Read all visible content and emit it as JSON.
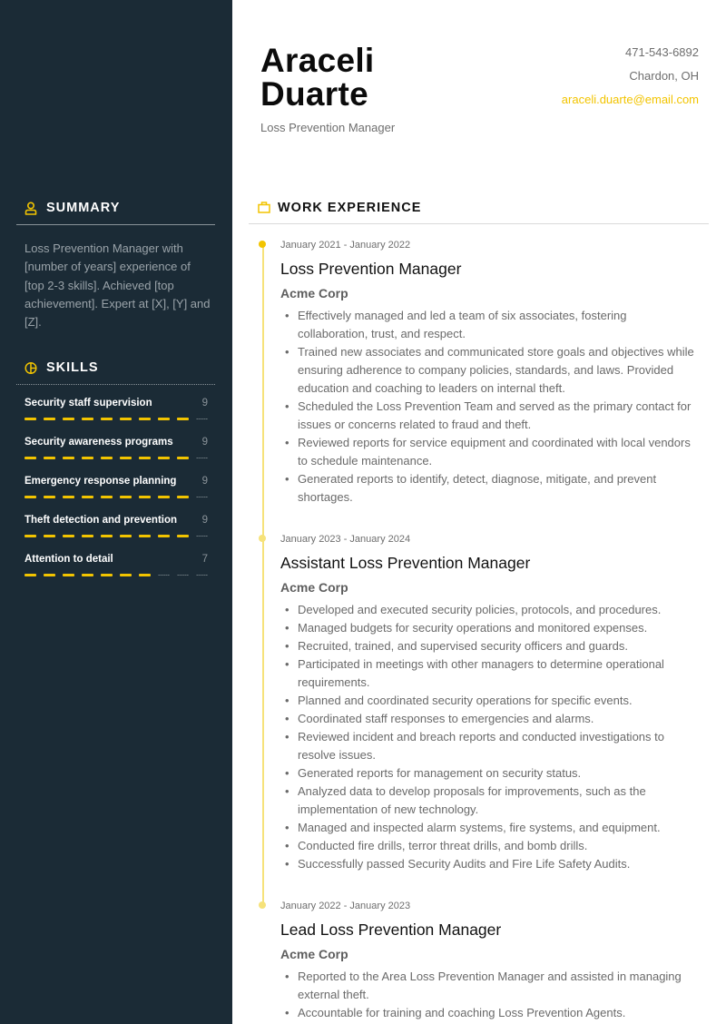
{
  "header": {
    "first_name": "Araceli",
    "last_name": "Duarte",
    "role": "Loss Prevention Manager",
    "phone": "471-543-6892",
    "location": "Chardon, OH",
    "email": "araceli.duarte@email.com"
  },
  "colors": {
    "sidebar_bg": "#1b2b36",
    "accent": "#f2c400"
  },
  "summary": {
    "title": "SUMMARY",
    "icon": "person-icon",
    "text": "Loss Prevention Manager with [number of years] experience of [top 2-3 skills]. Achieved [top achievement]. Expert at [X], [Y] and [Z]."
  },
  "skills": {
    "title": "SKILLS",
    "icon": "pie-chart-icon",
    "max": 10,
    "items": [
      {
        "name": "Security staff supervision",
        "value": "9",
        "level": 9
      },
      {
        "name": "Security awareness programs",
        "value": "9",
        "level": 9
      },
      {
        "name": "Emergency response planning",
        "value": "9",
        "level": 9
      },
      {
        "name": "Theft detection and prevention",
        "value": "9",
        "level": 9
      },
      {
        "name": "Attention to detail",
        "value": "7",
        "level": 7
      }
    ]
  },
  "work": {
    "title": "WORK EXPERIENCE",
    "icon": "briefcase-icon",
    "jobs": [
      {
        "dates": "January 2021 - January 2022",
        "title": "Loss Prevention Manager",
        "company": "Acme Corp",
        "bullets": [
          "Effectively managed and led a team of six associates, fostering collaboration, trust, and respect.",
          "Trained new associates and communicated store goals and objectives while ensuring adherence to company policies, standards, and laws. Provided education and coaching to leaders on internal theft.",
          "Scheduled the Loss Prevention Team and served as the primary contact for issues or concerns related to fraud and theft.",
          "Reviewed reports for service equipment and coordinated with local vendors to schedule maintenance.",
          "Generated reports to identify, detect, diagnose, mitigate, and prevent shortages."
        ]
      },
      {
        "dates": "January 2023 - January 2024",
        "title": "Assistant Loss Prevention Manager",
        "company": "Acme Corp",
        "bullets": [
          "Developed and executed security policies, protocols, and procedures.",
          "Managed budgets for security operations and monitored expenses.",
          "Recruited, trained, and supervised security officers and guards.",
          "Participated in meetings with other managers to determine operational requirements.",
          "Planned and coordinated security operations for specific events.",
          "Coordinated staff responses to emergencies and alarms.",
          "Reviewed incident and breach reports and conducted investigations to resolve issues.",
          "Generated reports for management on security status.",
          "Analyzed data to develop proposals for improvements, such as the implementation of new technology.",
          "Managed and inspected alarm systems, fire systems, and equipment.",
          "Conducted fire drills, terror threat drills, and bomb drills.",
          "Successfully passed Security Audits and Fire Life Safety Audits."
        ]
      },
      {
        "dates": "January 2022 - January 2023",
        "title": "Lead Loss Prevention Manager",
        "company": "Acme Corp",
        "bullets": [
          "Reported to the Area Loss Prevention Manager and assisted in managing external theft.",
          "Accountable for training and coaching Loss Prevention Agents."
        ]
      }
    ]
  }
}
